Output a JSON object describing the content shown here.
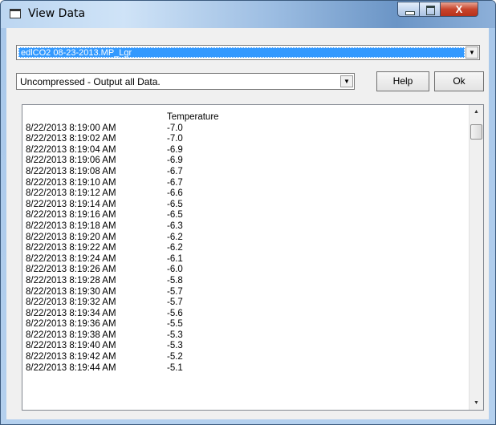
{
  "window": {
    "title": "View Data"
  },
  "controls": {
    "file_select": "edlCO2 08-23-2013.MP_Lgr",
    "mode_select": "Uncompressed - Output all Data.",
    "help_label": "Help",
    "ok_label": "Ok",
    "close_glyph": "X",
    "dropdown_glyph": "▼",
    "scroll_up_glyph": "▲",
    "scroll_down_glyph": "▼"
  },
  "list": {
    "header": "Temperature",
    "rows": [
      {
        "time": "8/22/2013  8:19:00 AM",
        "value": "-7.0"
      },
      {
        "time": "8/22/2013  8:19:02 AM",
        "value": "-7.0"
      },
      {
        "time": "8/22/2013  8:19:04 AM",
        "value": "-6.9"
      },
      {
        "time": "8/22/2013  8:19:06 AM",
        "value": "-6.9"
      },
      {
        "time": "8/22/2013  8:19:08 AM",
        "value": "-6.7"
      },
      {
        "time": "8/22/2013  8:19:10 AM",
        "value": "-6.7"
      },
      {
        "time": "8/22/2013  8:19:12 AM",
        "value": "-6.6"
      },
      {
        "time": "8/22/2013  8:19:14 AM",
        "value": "-6.5"
      },
      {
        "time": "8/22/2013  8:19:16 AM",
        "value": "-6.5"
      },
      {
        "time": "8/22/2013  8:19:18 AM",
        "value": "-6.3"
      },
      {
        "time": "8/22/2013  8:19:20 AM",
        "value": "-6.2"
      },
      {
        "time": "8/22/2013  8:19:22 AM",
        "value": "-6.2"
      },
      {
        "time": "8/22/2013  8:19:24 AM",
        "value": "-6.1"
      },
      {
        "time": "8/22/2013  8:19:26 AM",
        "value": "-6.0"
      },
      {
        "time": "8/22/2013  8:19:28 AM",
        "value": "-5.8"
      },
      {
        "time": "8/22/2013  8:19:30 AM",
        "value": "-5.7"
      },
      {
        "time": "8/22/2013  8:19:32 AM",
        "value": "-5.7"
      },
      {
        "time": "8/22/2013  8:19:34 AM",
        "value": "-5.6"
      },
      {
        "time": "8/22/2013  8:19:36 AM",
        "value": "-5.5"
      },
      {
        "time": "8/22/2013  8:19:38 AM",
        "value": "-5.3"
      },
      {
        "time": "8/22/2013  8:19:40 AM",
        "value": "-5.3"
      },
      {
        "time": "8/22/2013  8:19:42 AM",
        "value": "-5.2"
      },
      {
        "time": "8/22/2013  8:19:44 AM",
        "value": "-5.1"
      }
    ]
  },
  "colors": {
    "selection": "#3399ff",
    "close_button": "#c7442c"
  }
}
